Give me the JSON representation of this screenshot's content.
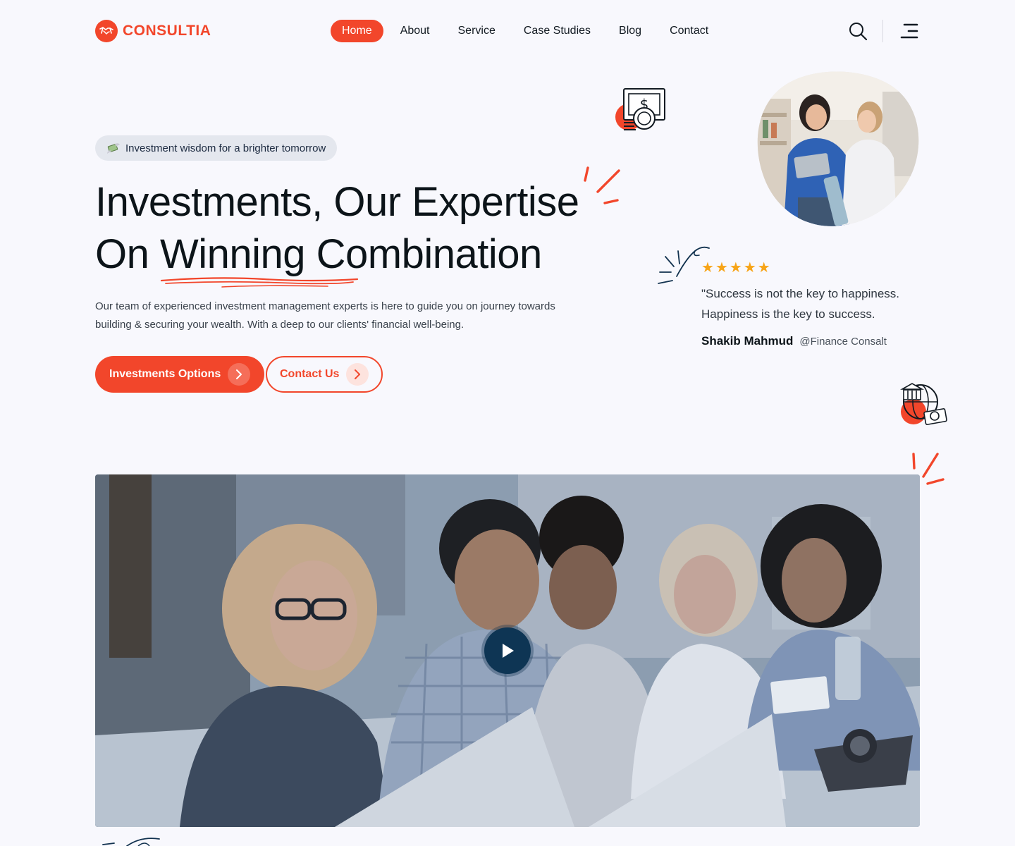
{
  "brand": {
    "name": "CONSULTIA",
    "color": "#f2462b"
  },
  "nav": {
    "items": [
      {
        "label": "Home",
        "active": true
      },
      {
        "label": "About",
        "active": false
      },
      {
        "label": "Service",
        "active": false
      },
      {
        "label": "Case Studies",
        "active": false
      },
      {
        "label": "Blog",
        "active": false
      },
      {
        "label": "Contact",
        "active": false
      }
    ]
  },
  "header_icons": [
    "search-icon",
    "menu-icon"
  ],
  "hero": {
    "badge": "Investment wisdom for a brighter tomorrow",
    "title_line1": "Investments, Our Expertise",
    "title_line2_pre": "On ",
    "title_line2_underlined": "Winning",
    "title_line2_post": " Combination",
    "description": "Our team of experienced investment management experts is here to guide you on journey towards building & securing your wealth. With a deep  to our clients' financial well-being.",
    "primary_button": "Investments Options",
    "secondary_button": "Contact Us"
  },
  "testimonial": {
    "stars": 5,
    "quote": "\"Success is not the key to happiness. Happiness is the key to success.",
    "author_name": "Shakib Mahmud",
    "author_handle": "@Finance Consalt"
  },
  "colors": {
    "accent": "#f2462b",
    "star": "#f7a417",
    "navy": "#0e3554",
    "background": "#f8f8fd"
  },
  "video": {
    "play_icon": "play-icon"
  }
}
